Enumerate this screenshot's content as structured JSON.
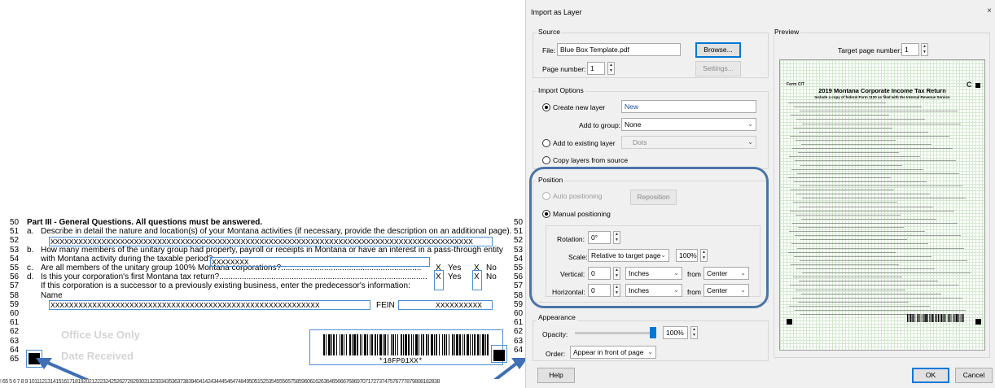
{
  "form": {
    "rows": [
      {
        "n": "50",
        "letter": "",
        "text": "Part III - General Questions. All questions must be answered.",
        "bold": true
      },
      {
        "n": "51",
        "letter": "a.",
        "text": "Describe in detail the nature and location(s) of your Montana activities (if necessary, provide the description on an additional page)."
      },
      {
        "n": "52",
        "letter": "",
        "text": ""
      },
      {
        "n": "53",
        "letter": "b.",
        "text": "How many members of the unitary group had property, payroll or receipts in Montana or have an interest in a pass-through entity"
      },
      {
        "n": "54",
        "letter": "",
        "text": "with Montana activity during the taxable period?"
      },
      {
        "n": "55",
        "letter": "c.",
        "text": "Are all members of the unitary group 100% Montana corporations?.............................................................."
      },
      {
        "n": "56",
        "letter": "d.",
        "text": "Is this your corporation's first Montana tax return?............................................................................................"
      },
      {
        "n": "57",
        "letter": "",
        "text": "If this corporation is a successor to a previously existing business, enter the predecessor's information:"
      },
      {
        "n": "58",
        "letter": "",
        "text": "Name"
      },
      {
        "n": "59",
        "letter": "",
        "text": ""
      },
      {
        "n": "60",
        "letter": "",
        "text": ""
      },
      {
        "n": "61",
        "letter": "",
        "text": ""
      },
      {
        "n": "62",
        "letter": "",
        "text": ""
      },
      {
        "n": "63",
        "letter": "",
        "text": ""
      },
      {
        "n": "64",
        "letter": "",
        "text": ""
      },
      {
        "n": "65",
        "letter": "",
        "text": ""
      }
    ],
    "x_line52": "XXXXXXXXXXXXXXXXXXXXXXXXXXXXXXXXXXXXXXXXXXXXXXXXXXXXXXXXXXXXXXXXXXXXXXXXXXXXXXXXXXXXXXXXXXX",
    "x_line54": "XXXXXXXX",
    "x_line58_name": "XXXXXXXXXXXXXXXXXXXXXXXXXXXXXXXXXXXXXXXXXXXXXXXXXXXXXXXXXX",
    "fein_label": "FEIN",
    "x_line58_fein": "XXXXXXXXXX",
    "yes_label": "Yes",
    "no_label": "No",
    "check_mark": "X",
    "office_use": "Office Use Only",
    "date_received": "Date Received",
    "barcode_text": "*18FP01XX*",
    "ruler_text": "! 65 5 6 7 8 9 10111213141516171819202122232425262728293031323334353637383940414243444546474849505152535455565758596061626364656667686970717273747576777879808182838"
  },
  "dialog": {
    "title": "Import as Layer",
    "close_glyph": "×",
    "source": {
      "label": "Source",
      "file_label": "File:",
      "file_value": "Blue Box Template.pdf",
      "browse": "Browse...",
      "page_number_label": "Page number:",
      "page_number_value": "1",
      "settings": "Settings..."
    },
    "import_options": {
      "label": "Import Options",
      "create_new_layer": "Create new layer",
      "new_layer_name": "New",
      "add_to_group_label": "Add to group:",
      "add_to_group_value": "None",
      "add_to_existing": "Add to existing layer",
      "existing_layer_value": "Dots",
      "copy_layers": "Copy layers from source"
    },
    "position": {
      "label": "Position",
      "auto": "Auto positioning",
      "reposition": "Reposition",
      "manual": "Manual positioning",
      "rotation_label": "Rotation:",
      "rotation_value": "0°",
      "scale_label": "Scale:",
      "scale_mode": "Relative to target page",
      "scale_value": "100%",
      "vertical_label": "Vertical:",
      "vertical_value": "0",
      "vertical_unit": "Inches",
      "from_label": "from",
      "vertical_from": "Center",
      "horizontal_label": "Horizontal:",
      "horizontal_value": "0",
      "horizontal_unit": "Inches",
      "horizontal_from": "Center"
    },
    "appearance": {
      "label": "Appearance",
      "opacity_label": "Opacity:",
      "opacity_value": "100%",
      "opacity_level": 1.0,
      "order_label": "Order:",
      "order_value": "Appear in front of page"
    },
    "preview": {
      "label": "Preview",
      "target_page_label": "Target page number:",
      "target_page_value": "1",
      "form_title": "2019 Montana Corporate Income Tax Return",
      "form_subtitle": "Include a copy of federal Form 1120 as filed with the Internal Revenue Service",
      "form_id": "Form CIT",
      "corner_letter": "C"
    },
    "help": "Help",
    "ok": "OK",
    "cancel": "Cancel"
  },
  "colors": {
    "highlight_blue": "#4a90d9",
    "position_ring": "#4a74a8",
    "arrow_blue": "#3f6fb5",
    "accent": "#0078d7"
  },
  "icons": {
    "spinner": "spinner-icon",
    "dropdown": "chevron-down-icon",
    "arrow": "pointer-arrow-icon"
  }
}
